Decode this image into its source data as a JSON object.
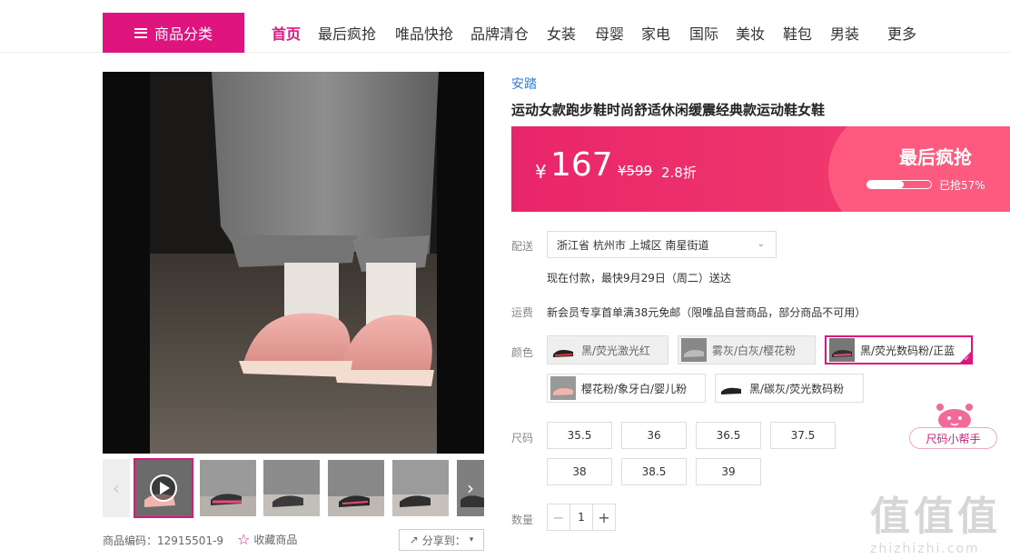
{
  "header": {
    "category_button": "商品分类",
    "nav": [
      "首页",
      "最后疯抢",
      "唯品快抢",
      "品牌清仓",
      "女装",
      "母婴",
      "家电",
      "国际",
      "美妆",
      "鞋包",
      "男装",
      "更多"
    ],
    "active_nav": "首页"
  },
  "gallery": {
    "product_code": "商品编码：12915501-9",
    "favorite": "收藏商品",
    "share": "分享到："
  },
  "product": {
    "brand": "安踏",
    "title": "运动女款跑步鞋时尚舒适休闲缓震经典款运动鞋女鞋"
  },
  "price": {
    "currency": "¥",
    "current": "167",
    "original": "¥599",
    "discount": "2.8折",
    "promo": "最后疯抢",
    "sold_text": "已抢57%",
    "sold_fraction": 0.57
  },
  "shipping": {
    "label": "配送",
    "address": "浙江省 杭州市 上城区 南星街道",
    "delivery": "现在付款，最快9月29日（周二）送达"
  },
  "freight": {
    "label": "运费",
    "text": "新会员专享首单满38元免邮（限唯品自营商品，部分商品不可用）"
  },
  "colors": {
    "label": "颜色",
    "options": [
      "黑/荧光激光红",
      "雾灰/白灰/樱花粉",
      "黑/荧光数码粉/正蓝",
      "樱花粉/象牙白/婴儿粉",
      "黑/碳灰/荧光数码粉"
    ],
    "selected": "黑/荧光数码粉/正蓝"
  },
  "sizes": {
    "label": "尺码",
    "options": [
      "35.5",
      "36",
      "36.5",
      "37.5",
      "38",
      "38.5",
      "39"
    ]
  },
  "quantity": {
    "label": "数量",
    "value": "1"
  },
  "helper": {
    "label": "尺码小帮手"
  },
  "watermark": {
    "big": "值值值",
    "small": "zhizhizhi.com"
  },
  "colors_theme": {
    "accent": "#e0147f",
    "price_band": "#ee3a6c",
    "brand_link": "#3a7bd5"
  }
}
